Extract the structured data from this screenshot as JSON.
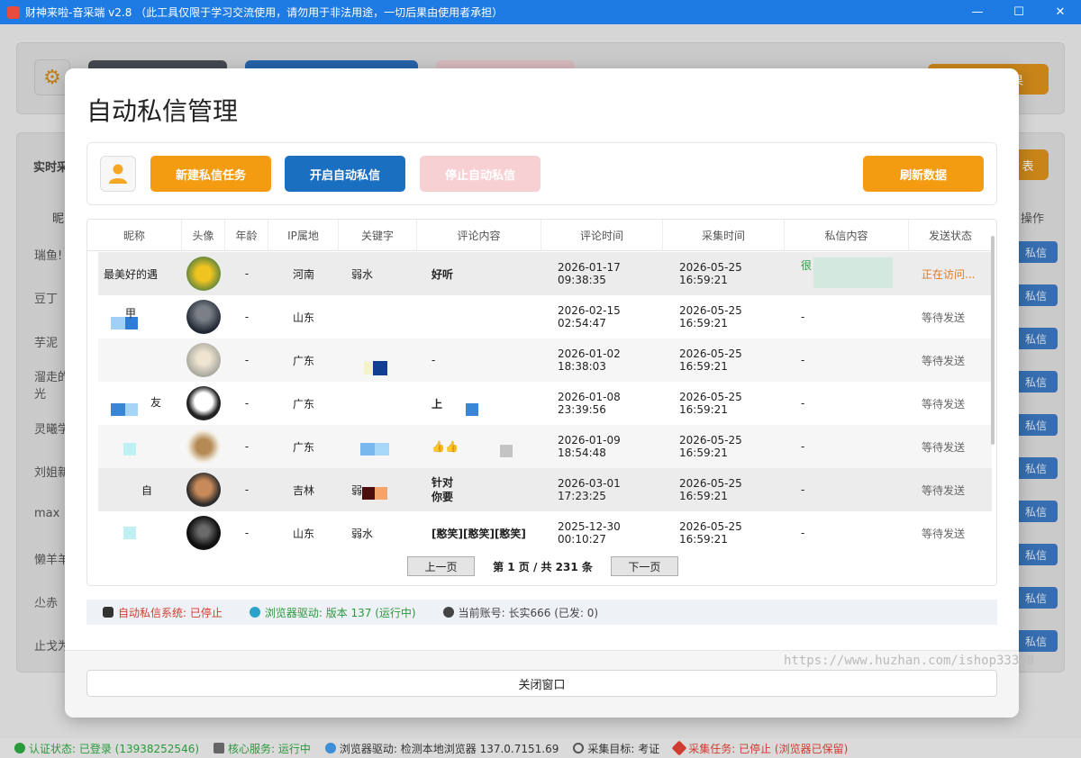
{
  "window": {
    "title": "财神来啦-音采端 v2.8 （此工具仅限于学习交流使用，请勿用于非法用途，一切后果由使用者承担）",
    "controls": [
      "—",
      "☐",
      "✕"
    ]
  },
  "background": {
    "left_labels": [
      "实时采",
      "昵",
      "瑞鱼!",
      "豆丁",
      "芋泥",
      "溜走的",
      "光",
      "灵曦学",
      "刘姐新",
      "max",
      "懒羊羊",
      "尐赤",
      "止戈为"
    ],
    "column_header_right": "操作",
    "private_btn": "私信",
    "right_btn_fragment": "表",
    "right_btn_fragment2": "果"
  },
  "modal": {
    "title": "自动私信管理",
    "toolbar": {
      "new_task": "新建私信任务",
      "start_auto": "开启自动私信",
      "stop_auto": "停止自动私信",
      "refresh": "刷新数据"
    },
    "table": {
      "headers": [
        "昵称",
        "头像",
        "年龄",
        "IP属地",
        "关键字",
        "评论内容",
        "评论时间",
        "采集时间",
        "私信内容",
        "发送状态"
      ],
      "rows": [
        {
          "nickname": "最美好的遇",
          "age": "-",
          "ip": "河南",
          "keyword": "弱水",
          "comment": "好听",
          "comment_date": "2026-01-17",
          "comment_time": "09:38:35",
          "collect_date": "2026-05-25",
          "collect_time": "16:59:21",
          "message": "很",
          "status": "正在访问..."
        },
        {
          "nickname": "甲",
          "age": "-",
          "ip": "山东",
          "keyword": "",
          "comment": "",
          "comment_date": "2026-02-15",
          "comment_time": "02:54:47",
          "collect_date": "2026-05-25",
          "collect_time": "16:59:21",
          "message": "-",
          "status": "等待发送"
        },
        {
          "nickname": "",
          "age": "-",
          "ip": "广东",
          "keyword": "",
          "comment": "-",
          "comment_date": "2026-01-02",
          "comment_time": "18:38:03",
          "collect_date": "2026-05-25",
          "collect_time": "16:59:21",
          "message": "-",
          "status": "等待发送"
        },
        {
          "nickname": "友",
          "age": "-",
          "ip": "广东",
          "keyword": "",
          "comment": "上",
          "comment_date": "2026-01-08",
          "comment_time": "23:39:56",
          "collect_date": "2026-05-25",
          "collect_time": "16:59:21",
          "message": "-",
          "status": "等待发送"
        },
        {
          "nickname": "",
          "age": "-",
          "ip": "广东",
          "keyword": "",
          "comment": "👍👍",
          "comment_date": "2026-01-09",
          "comment_time": "18:54:48",
          "collect_date": "2026-05-25",
          "collect_time": "16:59:21",
          "message": "-",
          "status": "等待发送"
        },
        {
          "nickname": "自",
          "age": "-",
          "ip": "吉林",
          "keyword": "弱",
          "comment": "针对\n你要",
          "comment_date": "2026-03-01",
          "comment_time": "17:23:25",
          "collect_date": "2026-05-25",
          "collect_time": "16:59:21",
          "message": "-",
          "status": "等待发送"
        },
        {
          "nickname": "",
          "age": "-",
          "ip": "山东",
          "keyword": "弱水",
          "comment": "[憨笑][憨笑][憨笑]",
          "comment_date": "2025-12-30",
          "comment_time": "00:10:27",
          "collect_date": "2026-05-25",
          "collect_time": "16:59:21",
          "message": "-",
          "status": "等待发送"
        }
      ]
    },
    "pager": {
      "prev": "上一页",
      "info": "第 1 页 / 共 231 条",
      "next": "下一页"
    },
    "status": {
      "auto_system": "自动私信系统: 已停止",
      "browser_driver": "浏览器驱动: 版本 137 (运行中)",
      "account": "当前账号: 长实666 (已发: 0)"
    },
    "close_label": "关闭窗口"
  },
  "statusbar": {
    "auth": "认证状态: 已登录 (13938252546)",
    "core": "核心服务: 运行中",
    "browser": "浏览器驱动: 检测本地浏览器 137.0.7151.69",
    "target": "采集目标: 考证",
    "task": "采集任务: 已停止 (浏览器已保留)"
  },
  "watermark": "https://www.huzhan.com/ishop33348",
  "colors": {
    "titlebar": "#1e7be4",
    "orange": "#f39c12",
    "blue": "#1a6fc0",
    "pink": "#f7d0d4",
    "status_red": "#d23b2f",
    "status_green": "#2a9a3c",
    "active_status": "#e07b22"
  }
}
